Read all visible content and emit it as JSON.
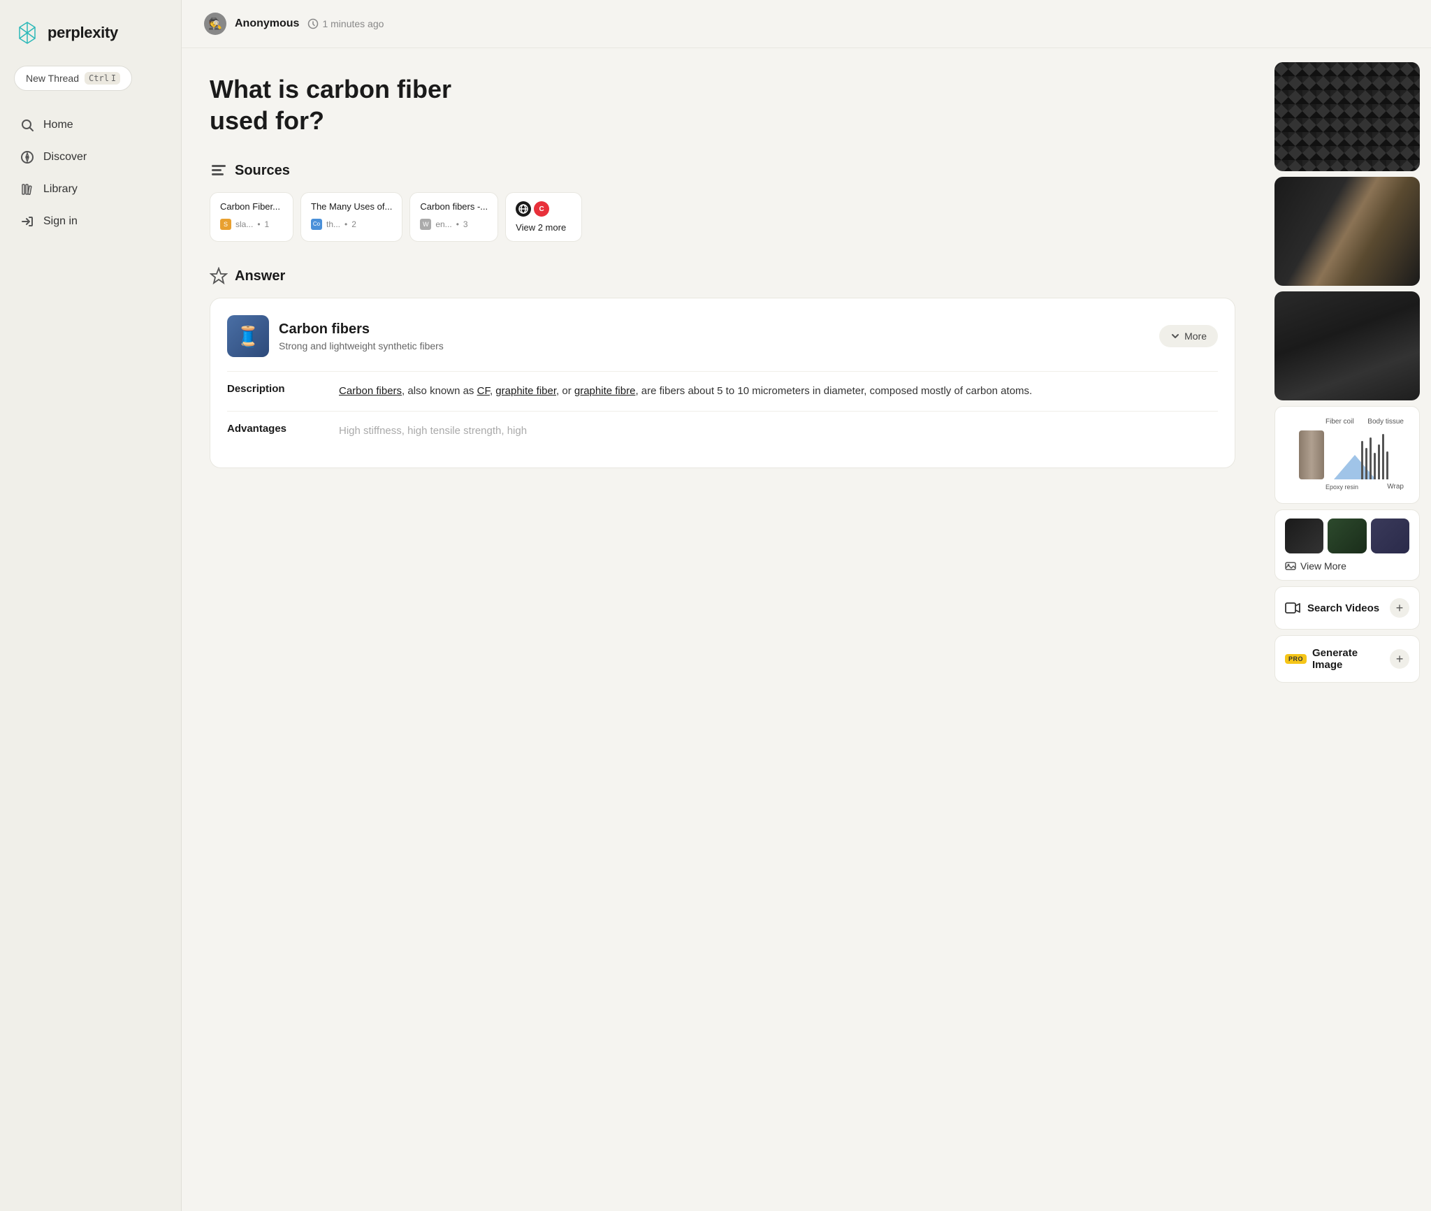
{
  "app": {
    "name": "perplexity"
  },
  "sidebar": {
    "new_thread_label": "New Thread",
    "kbd_ctrl": "Ctrl",
    "kbd_i": "I",
    "nav_items": [
      {
        "id": "home",
        "label": "Home",
        "icon": "search"
      },
      {
        "id": "discover",
        "label": "Discover",
        "icon": "compass"
      },
      {
        "id": "library",
        "label": "Library",
        "icon": "library"
      },
      {
        "id": "signin",
        "label": "Sign in",
        "icon": "signin"
      }
    ]
  },
  "topbar": {
    "username": "Anonymous",
    "timestamp": "1 minutes ago"
  },
  "main": {
    "question": "What is carbon fiber\nused for?",
    "sources_label": "Sources",
    "answer_label": "Answer",
    "sources": [
      {
        "title": "Carbon Fiber...",
        "site": "sla...",
        "num": "1",
        "favicon_color": "#e8a030",
        "favicon_letter": "S"
      },
      {
        "title": "The Many Uses of...",
        "site": "th...",
        "num": "2",
        "favicon_color": "#4a90d9",
        "favicon_letter": "Co"
      },
      {
        "title": "Carbon fibers -...",
        "site": "en...",
        "num": "3",
        "favicon_color": "#aaa",
        "favicon_letter": "W"
      }
    ],
    "view_more_label": "View 2 more",
    "answer_card": {
      "name": "Carbon fibers",
      "subtitle": "Strong and lightweight synthetic fibers",
      "more_label": "More",
      "description_label": "Description",
      "description_value": "Carbon fibers, also known as CF, graphite fiber, or graphite fibre, are fibers about 5 to 10 micrometers in diameter, composed mostly of carbon atoms.",
      "advantages_label": "Advantages",
      "advantages_value": "High stiffness, high tensile strength, high"
    }
  },
  "right_panel": {
    "diagram": {
      "label_fiber_coil": "Fiber coil",
      "label_body_tissue": "Body tissue",
      "label_epoxy_resin": "Epoxy resin",
      "label_wrap": "Wrap"
    },
    "view_more_label": "View More",
    "search_videos_label": "Search Videos",
    "generate_image_label": "Generate Image",
    "pro_badge": "PRO"
  }
}
